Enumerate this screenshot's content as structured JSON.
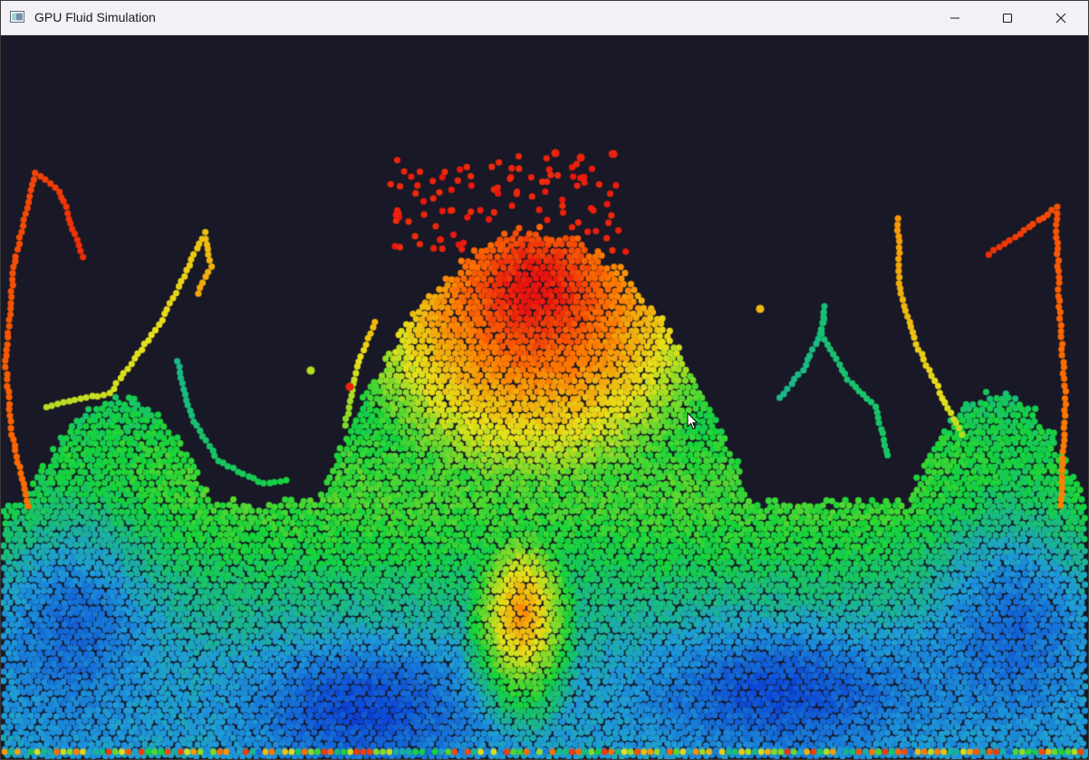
{
  "window": {
    "title": "GPU Fluid Simulation",
    "app_icon": "window-app-icon",
    "controls": {
      "minimize_icon": "minimize-icon",
      "maximize_icon": "maximize-icon",
      "close_icon": "close-icon"
    }
  },
  "simulation": {
    "background_color": "#181826",
    "particle_colormap": [
      "#0a3bd6",
      "#1f9bd9",
      "#16d43a",
      "#e6e11a",
      "#ff7a00",
      "#e8140e"
    ],
    "cursor_icon": "arrow-cursor-icon"
  }
}
